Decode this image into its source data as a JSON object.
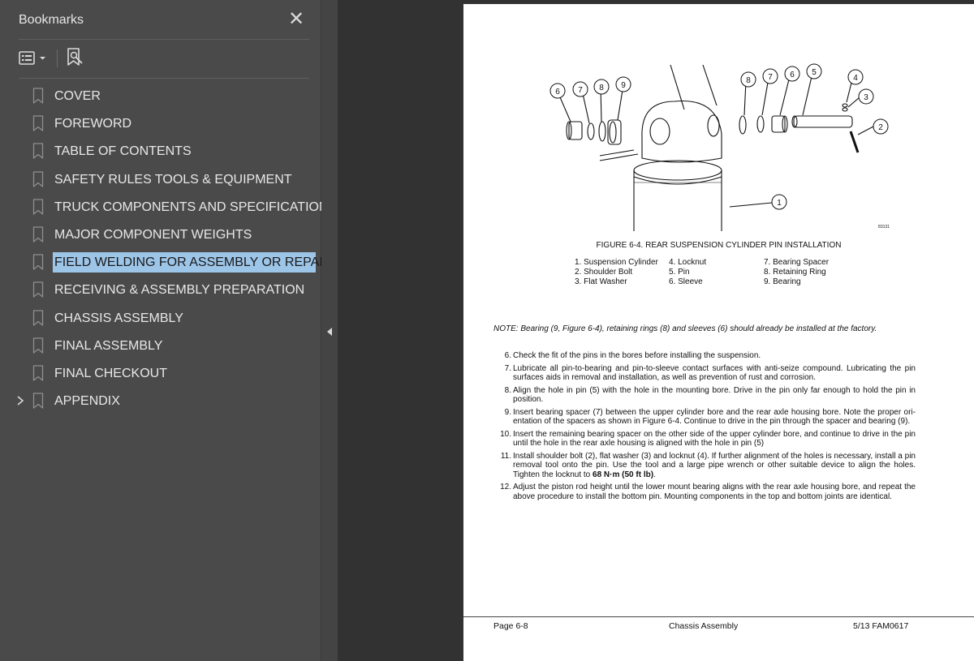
{
  "sidebar": {
    "title": "Bookmarks",
    "close_icon": "close-icon",
    "options_icon": "list-options-icon",
    "find_icon": "find-bookmark-icon",
    "selected_color": "#9dc5e8",
    "items": [
      {
        "label": "COVER"
      },
      {
        "label": "FOREWORD"
      },
      {
        "label": "TABLE OF CONTENTS"
      },
      {
        "label": "SAFETY RULES TOOLS & EQUIPMENT"
      },
      {
        "label": "TRUCK COMPONENTS AND SPECIFICATIONS"
      },
      {
        "label": "MAJOR COMPONENT WEIGHTS"
      },
      {
        "label": "FIELD WELDING FOR ASSEMBLY OR REPAIR",
        "selected": true
      },
      {
        "label": "RECEIVING & ASSEMBLY PREPARATION"
      },
      {
        "label": "CHASSIS ASSEMBLY"
      },
      {
        "label": "FINAL ASSEMBLY"
      },
      {
        "label": "FINAL CHECKOUT"
      },
      {
        "label": "APPENDIX",
        "expandable": true
      }
    ]
  },
  "page": {
    "figure_code": "83131",
    "callouts": [
      "1",
      "2",
      "3",
      "4",
      "5",
      "6",
      "7",
      "8",
      "9"
    ],
    "caption": "FIGURE 6-4. REAR SUSPENSION CYLINDER PIN INSTALLATION",
    "legend_col1": [
      "1. Suspension Cylinder",
      "2. Shoulder Bolt",
      "3. Flat Washer"
    ],
    "legend_col2": [
      "4. Locknut",
      "5. Pin",
      "6. Sleeve"
    ],
    "legend_col3": [
      "7. Bearing Spacer",
      "8. Retaining Ring",
      "9. Bearing"
    ],
    "note": "NOTE: Bearing (9, Figure 6-4), retaining rings (8) and sleeves (6) should already be installed at the factory.",
    "steps": [
      {
        "num": "6.",
        "text": "Check the fit of the pins in the bores before installing the suspension."
      },
      {
        "num": "7.",
        "text": "Lubricate all pin-to-bearing and pin-to-sleeve contact surfaces with anti-seize compound. Lubricating the pin surfaces aids in removal and installation, as well as prevention of rust and corrosion."
      },
      {
        "num": "8.",
        "text": "Align the hole in pin (5) with the hole in the mounting bore. Drive in the pin only far enough to hold the pin in position."
      },
      {
        "num": "9.",
        "text": "Insert bearing spacer (7) between the upper cylinder bore and the rear axle housing bore. Note the proper ori-entation of the spacers as shown in Figure 6-4. Continue to drive in the pin through the spacer and bearing (9)."
      },
      {
        "num": "10.",
        "text": "Insert the remaining bearing spacer on the other side of the upper cylinder bore, and continue to drive in the pin until the hole in the rear axle housing is aligned with the hole in pin (5)"
      },
      {
        "num": "11.",
        "text": "Install shoulder bolt (2), flat washer (3) and locknut (4). If further alignment of the holes is necessary, install a pin removal tool onto the pin. Use the tool and a large pipe wrench or other suitable device to align the holes. Tighten the locknut to ",
        "bold": "68 N·m (50 ft lb)",
        "after": "."
      },
      {
        "num": "12.",
        "text": "Adjust the piston rod height until the lower mount bearing aligns with the rear axle housing bore, and repeat the above procedure to install the bottom pin. Mounting components in the top and bottom joints are identical."
      }
    ],
    "footer_left": "Page 6-8",
    "footer_center": "Chassis Assembly",
    "footer_right": "5/13  FAM0617"
  }
}
